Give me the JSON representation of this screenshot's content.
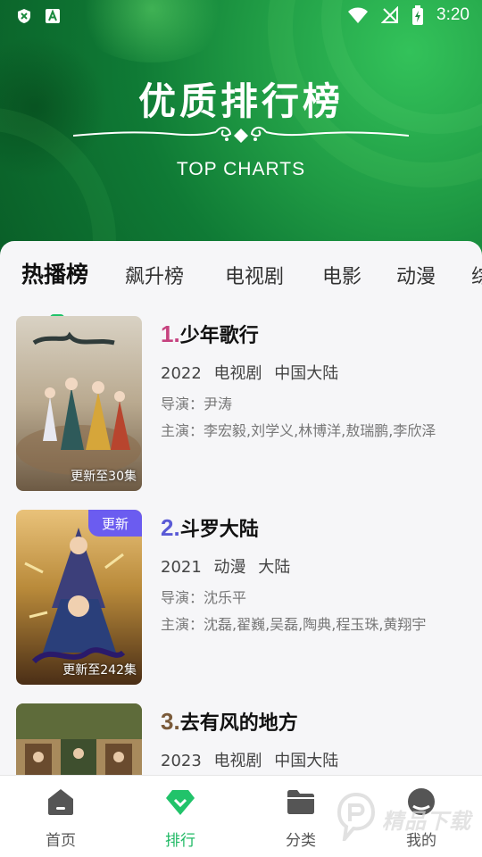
{
  "status_bar": {
    "time": "3:20",
    "left_icons": [
      "shield-icon",
      "a-icon"
    ],
    "right_icons": [
      "wifi-icon",
      "no-signal-icon",
      "battery-icon"
    ]
  },
  "banner": {
    "title": "优质排行榜",
    "subtitle": "TOP CHARTS"
  },
  "tabs": [
    {
      "label": "热播榜",
      "active": true
    },
    {
      "label": "飙升榜",
      "active": false
    },
    {
      "label": "电视剧",
      "active": false
    },
    {
      "label": "电影",
      "active": false
    },
    {
      "label": "动漫",
      "active": false
    },
    {
      "label": "综",
      "active": false
    }
  ],
  "items": [
    {
      "rank": "1.",
      "rank_color": "#c6427f",
      "title": "少年歌行",
      "year": "2022",
      "type": "电视剧",
      "region": "中国大陆",
      "director": "导演：尹涛",
      "cast": "主演：李宏毅,刘学义,林博洋,敖瑞鹏,李欣泽",
      "poster_caption": "更新至30集",
      "badge": ""
    },
    {
      "rank": "2.",
      "rank_color": "#5a5ad6",
      "title": "斗罗大陆",
      "year": "2021",
      "type": "动漫",
      "region": "大陆",
      "director": "导演：沈乐平",
      "cast": "主演：沈磊,翟巍,吴磊,陶典,程玉珠,黄翔宇",
      "poster_caption": "更新至242集",
      "badge": "更新"
    },
    {
      "rank": "3.",
      "rank_color": "#7a5a3a",
      "title": "去有风的地方",
      "year": "2023",
      "type": "电视剧",
      "region": "中国大陆",
      "director": "",
      "cast": "",
      "poster_caption": "",
      "badge": ""
    }
  ],
  "bottom_nav": [
    {
      "label": "首页",
      "icon": "home-icon",
      "active": false
    },
    {
      "label": "排行",
      "icon": "diamond-icon",
      "active": true
    },
    {
      "label": "分类",
      "icon": "folder-icon",
      "active": false
    },
    {
      "label": "我的",
      "icon": "profile-icon",
      "active": false
    }
  ],
  "watermark": "精品下载",
  "colors": {
    "accent": "#1fb964",
    "banner": "#148a3d",
    "badge": "#6b5cf0"
  }
}
